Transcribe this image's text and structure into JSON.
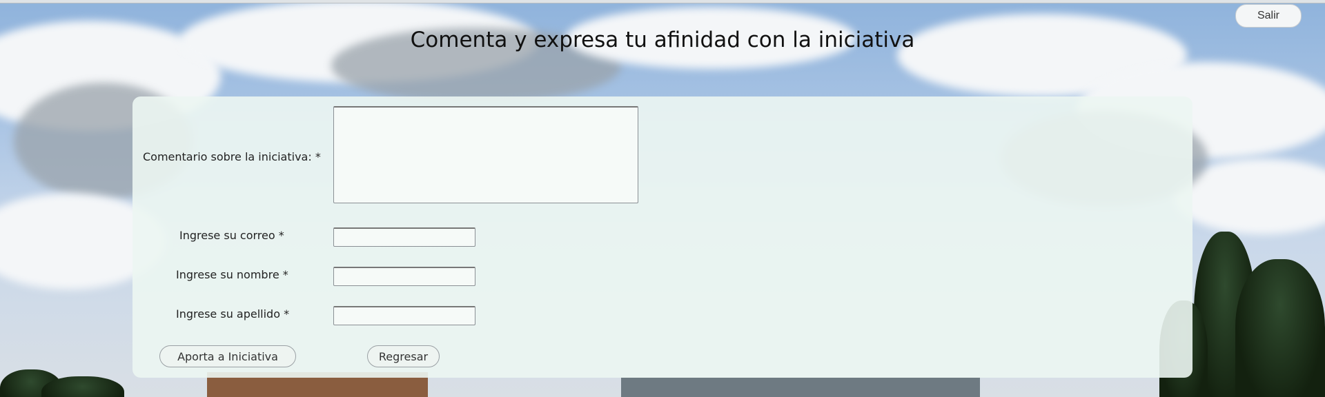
{
  "header": {
    "logout_label": "Salir",
    "title": "Comenta y expresa tu afinidad con la iniciativa"
  },
  "form": {
    "comment_label": "Comentario sobre la iniciativa: *",
    "comment_value": "",
    "email_label": "Ingrese su correo *",
    "email_value": "",
    "name_label": "Ingrese su nombre *",
    "name_value": "",
    "lastname_label": "Ingrese su apellido *",
    "lastname_value": "",
    "submit_label": "Aporta a Iniciativa",
    "back_label": "Regresar"
  }
}
